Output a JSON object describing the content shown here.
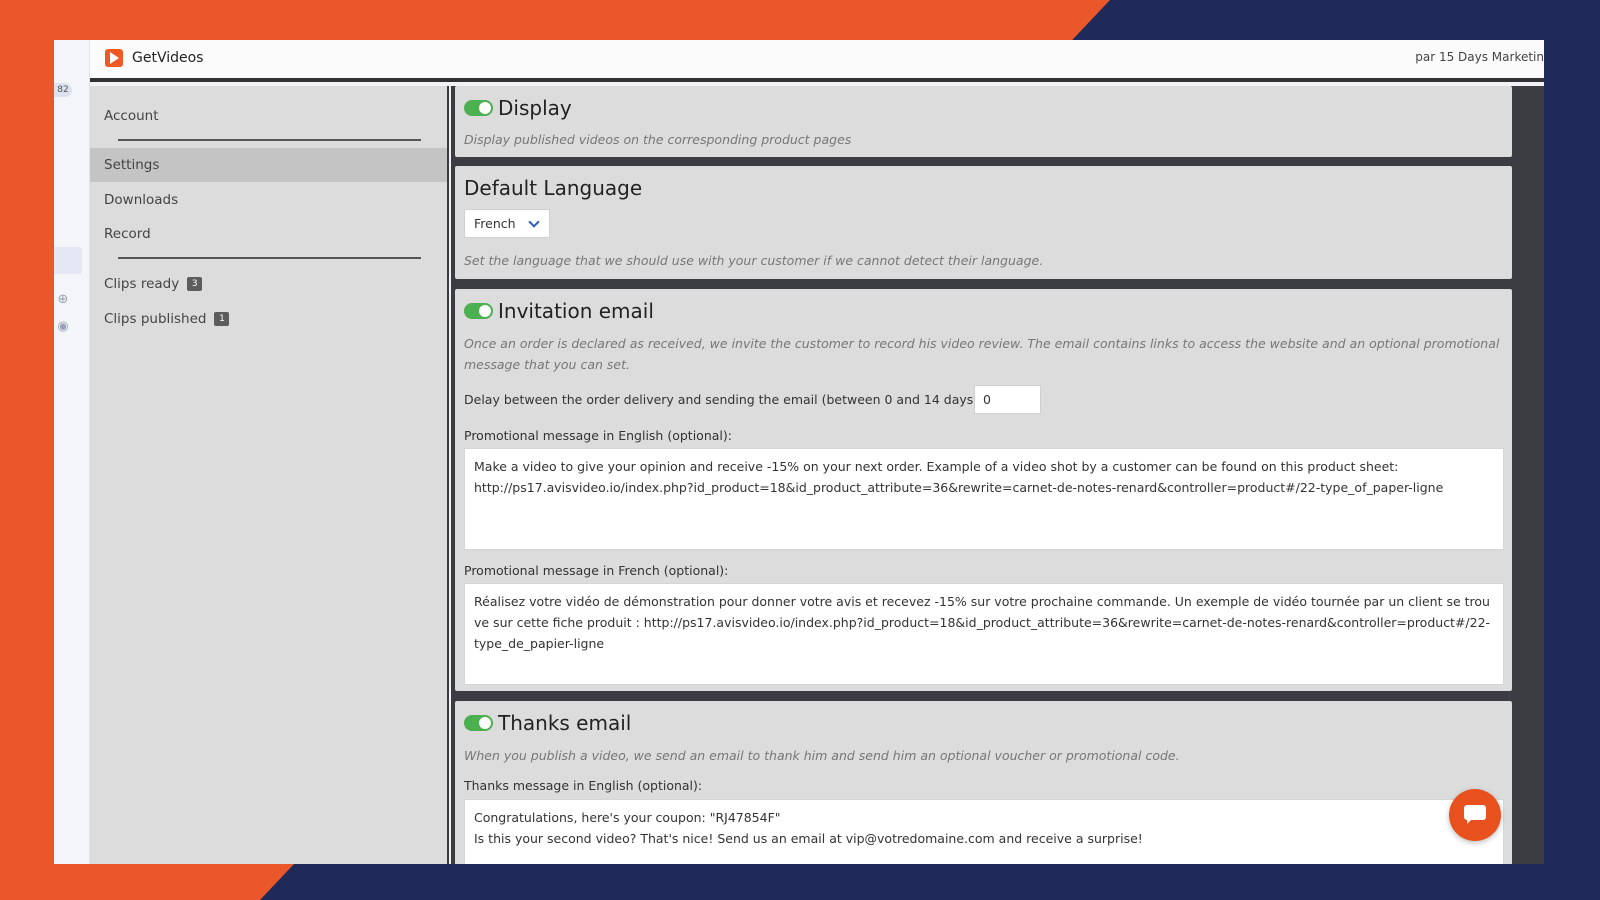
{
  "app": {
    "title": "GetVideos",
    "topbar_right": "par 15 Days Marketin",
    "strip_badge": "82"
  },
  "colors": {
    "accent_orange": "#e9572a",
    "navy": "#1f2a5a",
    "toggle_on": "#4caf50"
  },
  "sidebar": {
    "account": "Account",
    "settings": "Settings",
    "downloads": "Downloads",
    "record": "Record",
    "clips_ready": {
      "label": "Clips ready",
      "count": "3"
    },
    "clips_published": {
      "label": "Clips published",
      "count": "1"
    }
  },
  "display": {
    "enabled": true,
    "title": "Display",
    "description": "Display published videos on the corresponding product pages"
  },
  "language": {
    "title": "Default Language",
    "selected": "French",
    "description": "Set the language that we should use with your customer if we cannot detect their language."
  },
  "invitation": {
    "enabled": true,
    "title": "Invitation email",
    "description": "Once an order is declared as received, we invite the customer to record his video review. The email contains links to access the website and an optional promotional message that you can set.",
    "delay_label": "Delay between the order delivery and sending the email (between 0 and 14 days):",
    "delay_value": "0",
    "promo_en_label": "Promotional message in English (optional):",
    "promo_en_value": "Make a video to give your opinion and receive -15% on your next order. Example of a video shot by a customer can be found on this product sheet:\nhttp://ps17.avisvideo.io/index.php?id_product=18&id_product_attribute=36&rewrite=carnet-de-notes-renard&controller=product#/22-type_of_paper-ligne",
    "promo_fr_label": "Promotional message in French (optional):",
    "promo_fr_value": "Réalisez votre vidéo de démonstration pour donner votre avis et recevez -15% sur votre prochaine commande. Un exemple de vidéo tournée par un client se trouve sur cette fiche produit : http://ps17.avisvideo.io/index.php?id_product=18&id_product_attribute=36&rewrite=carnet-de-notes-renard&controller=product#/22-type_de_papier-ligne"
  },
  "thanks": {
    "enabled": true,
    "title": "Thanks email",
    "description": "When you publish a video, we send an email to thank him and send him an optional voucher or promotional code.",
    "msg_en_label": "Thanks message in English (optional):",
    "msg_en_value": "Congratulations, here's your coupon: \"RJ47854F\"\nIs this your second video? That's nice! Send us an email at vip@votredomaine.com and receive a surprise!"
  }
}
